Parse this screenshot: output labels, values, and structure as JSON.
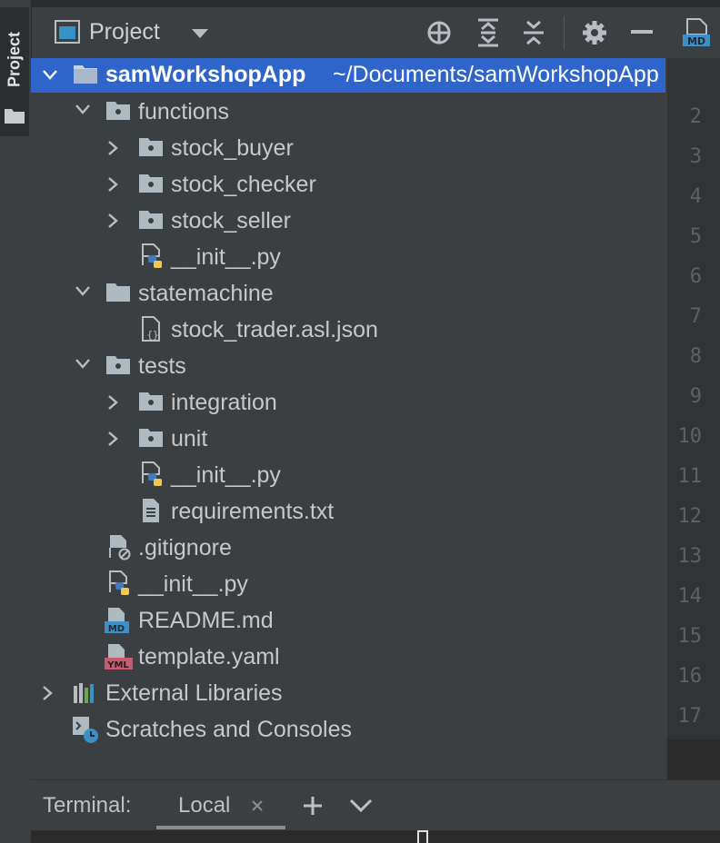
{
  "sidebar": {
    "tab_label": "Project",
    "icon": "folder-icon"
  },
  "panel_header": {
    "title": "Project",
    "icons": [
      "project-view-icon",
      "dropdown-chevron-icon",
      "locate-target-icon",
      "expand-all-icon",
      "collapse-all-icon",
      "gear-icon",
      "minimize-icon"
    ]
  },
  "tree": {
    "root_name": "samWorkshopApp",
    "root_path": "~/Documents/samWorkshopApp",
    "items": [
      {
        "label": "functions"
      },
      {
        "label": "stock_buyer"
      },
      {
        "label": "stock_checker"
      },
      {
        "label": "stock_seller"
      },
      {
        "label": "__init__.py"
      },
      {
        "label": "statemachine"
      },
      {
        "label": "stock_trader.asl.json"
      },
      {
        "label": "tests"
      },
      {
        "label": "integration"
      },
      {
        "label": "unit"
      },
      {
        "label": "__init__.py"
      },
      {
        "label": "requirements.txt"
      },
      {
        "label": ".gitignore"
      },
      {
        "label": "__init__.py"
      },
      {
        "label": "README.md"
      },
      {
        "label": "template.yaml"
      },
      {
        "label": "External Libraries"
      },
      {
        "label": "Scratches and Consoles"
      }
    ]
  },
  "editor": {
    "tab_icon_text": "MD",
    "line_numbers": [
      "2",
      "3",
      "4",
      "5",
      "6",
      "7",
      "8",
      "9",
      "10",
      "11",
      "12",
      "13",
      "14",
      "15",
      "16",
      "17"
    ]
  },
  "terminal": {
    "label": "Terminal:",
    "tab_label": "Local"
  },
  "colors": {
    "selection": "#2f65ca",
    "panel_bg": "#3c3f41",
    "folder_icon": "#aeb9c0",
    "python_blue": "#3f7cbf",
    "python_yellow": "#f2c94c",
    "md_blue": "#3d8fc6",
    "yml_red": "#c75b72"
  }
}
